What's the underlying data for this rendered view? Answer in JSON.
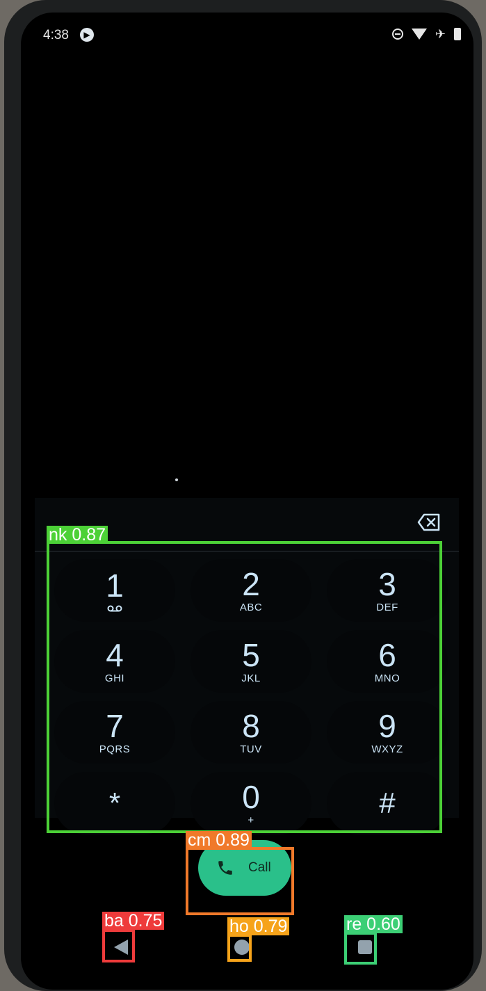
{
  "status_bar": {
    "time": "4:38",
    "icons": [
      "media-badge-icon",
      "do-not-disturb-icon",
      "wifi-icon",
      "airplane-icon",
      "battery-icon"
    ]
  },
  "dialpad": {
    "keys": [
      {
        "digit": "1",
        "letters": "",
        "icon": "voicemail-icon"
      },
      {
        "digit": "2",
        "letters": "ABC"
      },
      {
        "digit": "3",
        "letters": "DEF"
      },
      {
        "digit": "4",
        "letters": "GHI"
      },
      {
        "digit": "5",
        "letters": "JKL"
      },
      {
        "digit": "6",
        "letters": "MNO"
      },
      {
        "digit": "7",
        "letters": "PQRS"
      },
      {
        "digit": "8",
        "letters": "TUV"
      },
      {
        "digit": "9",
        "letters": "WXYZ"
      },
      {
        "digit": "*",
        "letters": ""
      },
      {
        "digit": "0",
        "letters": "+"
      },
      {
        "digit": "#",
        "letters": ""
      }
    ]
  },
  "call_button": {
    "label": "Call",
    "icon": "phone-icon"
  },
  "navigation": {
    "back": "back-icon",
    "home": "home-icon",
    "recents": "recents-icon"
  },
  "detections": [
    {
      "label": "nk 0.87",
      "color": "#4cd137"
    },
    {
      "label": "cm 0.89",
      "color": "#f0792a"
    },
    {
      "label": "ba 0.75",
      "color": "#ee3b3b"
    },
    {
      "label": "ho 0.79",
      "color": "#f6a31a"
    },
    {
      "label": "re 0.60",
      "color": "#3ccf75"
    }
  ],
  "colors": {
    "accent": "#2ac08a",
    "key_text": "#cbe4f6",
    "background": "#000000"
  }
}
